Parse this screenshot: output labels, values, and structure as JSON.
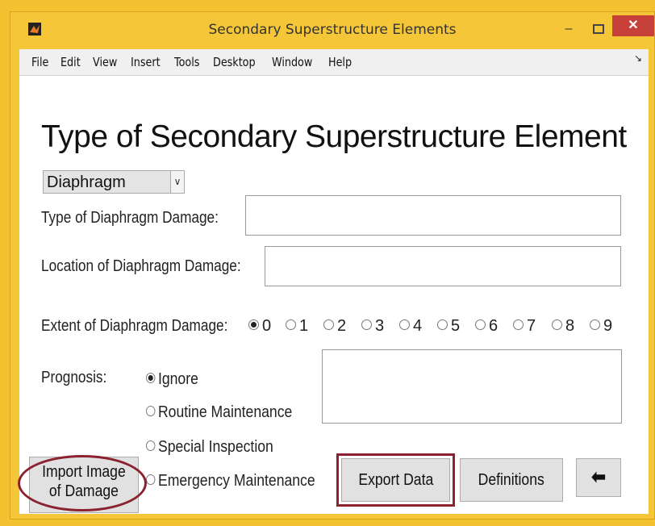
{
  "window": {
    "title": "Secondary Superstructure Elements"
  },
  "window_controls": {
    "minimize": "–",
    "maximize": "□",
    "close": "✕"
  },
  "menu": [
    "File",
    "Edit",
    "View",
    "Insert",
    "Tools",
    "Desktop",
    "Window",
    "Help"
  ],
  "heading": "Type of Secondary Superstructure Element",
  "element_type": {
    "selected": "Diaphragm"
  },
  "fields": {
    "damage_type_label": "Type of Diaphragm Damage:",
    "damage_type_value": "",
    "damage_location_label": "Location of Diaphragm Damage:",
    "damage_location_value": ""
  },
  "extent": {
    "label": "Extent of Diaphragm Damage:",
    "options": [
      "0",
      "1",
      "2",
      "3",
      "4",
      "5",
      "6",
      "7",
      "8",
      "9"
    ],
    "selected": "0"
  },
  "prognosis": {
    "label": "Prognosis:",
    "options": [
      "Ignore",
      "Routine Maintenance",
      "Special Inspection",
      "Emergency Maintenance"
    ],
    "selected": "Ignore",
    "notes": ""
  },
  "buttons": {
    "import_line1": "Import Image",
    "import_line2": "of Damage",
    "export": "Export Data",
    "definitions": "Definitions",
    "back_icon": "back-arrow-icon"
  },
  "annotation_color": "#8b2230"
}
